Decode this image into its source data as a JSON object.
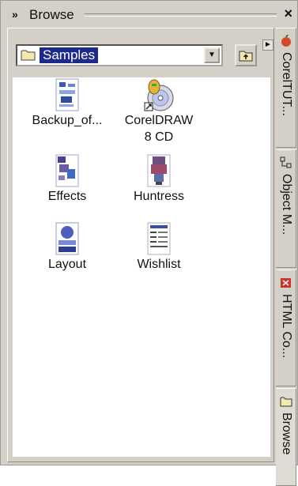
{
  "window": {
    "title": "Browse"
  },
  "location": {
    "value": "Samples"
  },
  "files": [
    {
      "name": "Backup_of...",
      "icon": "document-thumbnail-icon"
    },
    {
      "name": "CorelDRAW\n8 CD",
      "icon": "cd-disc-icon"
    },
    {
      "name": "Effects",
      "icon": "document-thumbnail-icon"
    },
    {
      "name": "Huntress",
      "icon": "document-thumbnail-icon"
    },
    {
      "name": "Layout",
      "icon": "document-thumbnail-icon"
    },
    {
      "name": "Wishlist",
      "icon": "document-thumbnail-icon"
    }
  ],
  "tabs": [
    {
      "label": "CorelTUT...",
      "icon": "corel-icon"
    },
    {
      "label": "Object M...",
      "icon": "object-manager-icon"
    },
    {
      "label": "HTML Co...",
      "icon": "html-icon"
    },
    {
      "label": "Browse",
      "icon": "folder-icon"
    }
  ],
  "colors": {
    "selection": "#1c2a8c",
    "panel": "#d4d0c8"
  }
}
